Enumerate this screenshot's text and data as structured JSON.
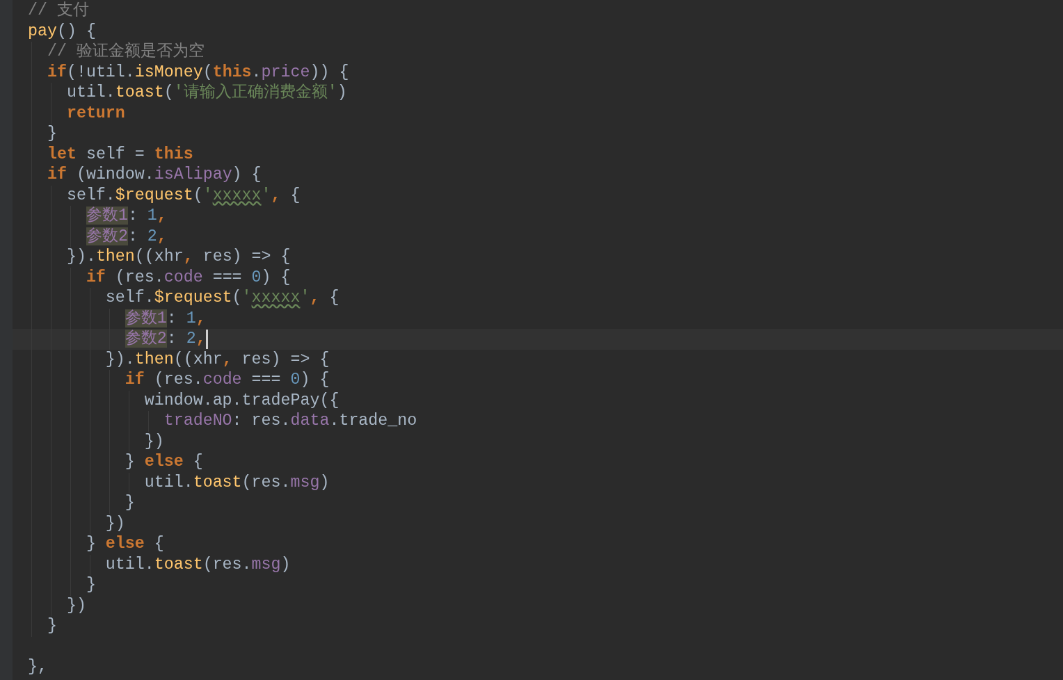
{
  "editor": {
    "lines": [
      {
        "tokens": [
          {
            "t": "// 支付",
            "kind": "cmt"
          }
        ]
      },
      {
        "tokens": [
          {
            "t": "pay",
            "kind": "fn"
          },
          {
            "t": "() {",
            "kind": "plain"
          }
        ]
      },
      {
        "tokens": [
          {
            "t": "  // 验证金额是否为空",
            "kind": "cmt"
          }
        ]
      },
      {
        "tokens": [
          {
            "t": "  if",
            "kind": "kw"
          },
          {
            "t": "(!util.",
            "kind": "plain"
          },
          {
            "t": "isMoney",
            "kind": "fn"
          },
          {
            "t": "(",
            "kind": "plain"
          },
          {
            "t": "this",
            "kind": "kw"
          },
          {
            "t": ".",
            "kind": "plain"
          },
          {
            "t": "price",
            "kind": "prop"
          },
          {
            "t": ")) {",
            "kind": "plain"
          }
        ]
      },
      {
        "tokens": [
          {
            "t": "    util.",
            "kind": "plain"
          },
          {
            "t": "toast",
            "kind": "fn"
          },
          {
            "t": "(",
            "kind": "plain"
          },
          {
            "t": "'请输入正确消费金额'",
            "kind": "str"
          },
          {
            "t": ")",
            "kind": "plain"
          }
        ]
      },
      {
        "tokens": [
          {
            "t": "    return",
            "kind": "kw"
          }
        ]
      },
      {
        "tokens": [
          {
            "t": "  }",
            "kind": "plain"
          }
        ]
      },
      {
        "tokens": [
          {
            "t": "  let",
            "kind": "kw"
          },
          {
            "t": " self = ",
            "kind": "plain"
          },
          {
            "t": "this",
            "kind": "kw"
          }
        ]
      },
      {
        "tokens": [
          {
            "t": "  if",
            "kind": "kw"
          },
          {
            "t": " (window.",
            "kind": "plain"
          },
          {
            "t": "isAlipay",
            "kind": "prop"
          },
          {
            "t": ") {",
            "kind": "plain"
          }
        ]
      },
      {
        "tokens": [
          {
            "t": "    self.",
            "kind": "plain"
          },
          {
            "t": "$request",
            "kind": "fn"
          },
          {
            "t": "(",
            "kind": "plain"
          },
          {
            "t": "'",
            "kind": "str"
          },
          {
            "t": "xxxxx",
            "kind": "typo"
          },
          {
            "t": "'",
            "kind": "str"
          },
          {
            "t": ", ",
            "kind": "kw"
          },
          {
            "t": "{",
            "kind": "plain"
          }
        ]
      },
      {
        "tokens": [
          {
            "t": "      参数1",
            "kind": "param"
          },
          {
            "t": ": ",
            "kind": "plain"
          },
          {
            "t": "1",
            "kind": "num"
          },
          {
            "t": ",",
            "kind": "kw"
          }
        ]
      },
      {
        "tokens": [
          {
            "t": "      参数2",
            "kind": "param"
          },
          {
            "t": ": ",
            "kind": "plain"
          },
          {
            "t": "2",
            "kind": "num"
          },
          {
            "t": ",",
            "kind": "kw"
          }
        ]
      },
      {
        "tokens": [
          {
            "t": "    }).",
            "kind": "plain"
          },
          {
            "t": "then",
            "kind": "fn"
          },
          {
            "t": "((xhr",
            "kind": "plain"
          },
          {
            "t": ", ",
            "kind": "kw"
          },
          {
            "t": "res) => {",
            "kind": "plain"
          }
        ]
      },
      {
        "tokens": [
          {
            "t": "      if",
            "kind": "kw"
          },
          {
            "t": " (res.",
            "kind": "plain"
          },
          {
            "t": "code",
            "kind": "prop"
          },
          {
            "t": " === ",
            "kind": "plain"
          },
          {
            "t": "0",
            "kind": "num"
          },
          {
            "t": ") {",
            "kind": "plain"
          }
        ]
      },
      {
        "tokens": [
          {
            "t": "        self.",
            "kind": "plain"
          },
          {
            "t": "$request",
            "kind": "fn"
          },
          {
            "t": "(",
            "kind": "plain"
          },
          {
            "t": "'",
            "kind": "str"
          },
          {
            "t": "xxxxx",
            "kind": "typo"
          },
          {
            "t": "'",
            "kind": "str"
          },
          {
            "t": ", ",
            "kind": "kw"
          },
          {
            "t": "{",
            "kind": "plain"
          }
        ]
      },
      {
        "tokens": [
          {
            "t": "          参数1",
            "kind": "param"
          },
          {
            "t": ": ",
            "kind": "plain"
          },
          {
            "t": "1",
            "kind": "num"
          },
          {
            "t": ",",
            "kind": "kw"
          }
        ]
      },
      {
        "tokens": [
          {
            "t": "          参数2",
            "kind": "param"
          },
          {
            "t": ": ",
            "kind": "plain"
          },
          {
            "t": "2",
            "kind": "num"
          },
          {
            "t": ",",
            "kind": "kw"
          }
        ],
        "cursor": true
      },
      {
        "tokens": [
          {
            "t": "        }).",
            "kind": "plain"
          },
          {
            "t": "then",
            "kind": "fn"
          },
          {
            "t": "((xhr",
            "kind": "plain"
          },
          {
            "t": ", ",
            "kind": "kw"
          },
          {
            "t": "res) => {",
            "kind": "plain"
          }
        ]
      },
      {
        "tokens": [
          {
            "t": "          if",
            "kind": "kw"
          },
          {
            "t": " (res.",
            "kind": "plain"
          },
          {
            "t": "code",
            "kind": "prop"
          },
          {
            "t": " === ",
            "kind": "plain"
          },
          {
            "t": "0",
            "kind": "num"
          },
          {
            "t": ") {",
            "kind": "plain"
          }
        ]
      },
      {
        "tokens": [
          {
            "t": "            window.ap.tradePay({",
            "kind": "plain"
          }
        ]
      },
      {
        "tokens": [
          {
            "t": "              tradeNO",
            "kind": "prop"
          },
          {
            "t": ": res.",
            "kind": "plain"
          },
          {
            "t": "data",
            "kind": "prop"
          },
          {
            "t": ".trade_no",
            "kind": "plain"
          }
        ]
      },
      {
        "tokens": [
          {
            "t": "            })",
            "kind": "plain"
          }
        ]
      },
      {
        "tokens": [
          {
            "t": "          } ",
            "kind": "plain"
          },
          {
            "t": "else",
            "kind": "kw"
          },
          {
            "t": " {",
            "kind": "plain"
          }
        ]
      },
      {
        "tokens": [
          {
            "t": "            util.",
            "kind": "plain"
          },
          {
            "t": "toast",
            "kind": "fn"
          },
          {
            "t": "(res.",
            "kind": "plain"
          },
          {
            "t": "msg",
            "kind": "prop"
          },
          {
            "t": ")",
            "kind": "plain"
          }
        ]
      },
      {
        "tokens": [
          {
            "t": "          }",
            "kind": "plain"
          }
        ]
      },
      {
        "tokens": [
          {
            "t": "        })",
            "kind": "plain"
          }
        ]
      },
      {
        "tokens": [
          {
            "t": "      } ",
            "kind": "plain"
          },
          {
            "t": "else",
            "kind": "kw"
          },
          {
            "t": " {",
            "kind": "plain"
          }
        ]
      },
      {
        "tokens": [
          {
            "t": "        util.",
            "kind": "plain"
          },
          {
            "t": "toast",
            "kind": "fn"
          },
          {
            "t": "(res.",
            "kind": "plain"
          },
          {
            "t": "msg",
            "kind": "prop"
          },
          {
            "t": ")",
            "kind": "plain"
          }
        ]
      },
      {
        "tokens": [
          {
            "t": "      }",
            "kind": "plain"
          }
        ]
      },
      {
        "tokens": [
          {
            "t": "    })",
            "kind": "plain"
          }
        ]
      },
      {
        "tokens": [
          {
            "t": "  }",
            "kind": "plain"
          }
        ]
      },
      {
        "kind": "blank"
      },
      {
        "tokens": [
          {
            "t": "},",
            "kind": "plain"
          }
        ]
      }
    ]
  }
}
